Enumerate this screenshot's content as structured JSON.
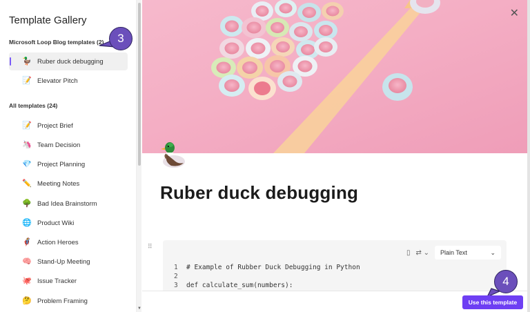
{
  "sidebar": {
    "title": "Template Gallery",
    "sections": [
      {
        "label": "Microsoft Loop Blog templates (2)",
        "items": [
          {
            "label": "Ruber duck debugging",
            "icon": "duck-icon",
            "glyph": "🦆",
            "active": true
          },
          {
            "label": "Elevator Pitch",
            "icon": "pencil-paper-icon",
            "glyph": "📝",
            "active": false
          }
        ]
      },
      {
        "label": "All templates (24)",
        "items": [
          {
            "label": "Project Brief",
            "icon": "memo-icon",
            "glyph": "📝"
          },
          {
            "label": "Team Decision",
            "icon": "unicorn-icon",
            "glyph": "🦄"
          },
          {
            "label": "Project Planning",
            "icon": "gem-icon",
            "glyph": "💎"
          },
          {
            "label": "Meeting Notes",
            "icon": "pencil-icon",
            "glyph": "✏️"
          },
          {
            "label": "Bad Idea Brainstorm",
            "icon": "tree-icon",
            "glyph": "🌳"
          },
          {
            "label": "Product Wiki",
            "icon": "globe-icon",
            "glyph": "🌐"
          },
          {
            "label": "Action Heroes",
            "icon": "superhero-icon",
            "glyph": "🦸"
          },
          {
            "label": "Stand-Up Meeting",
            "icon": "brain-icon",
            "glyph": "🧠"
          },
          {
            "label": "Issue Tracker",
            "icon": "octopus-icon",
            "glyph": "🐙"
          },
          {
            "label": "Problem Framing",
            "icon": "thinking-face-icon",
            "glyph": "🤔"
          }
        ]
      }
    ]
  },
  "callouts": {
    "step_sidebar": "3",
    "step_button": "4"
  },
  "preview": {
    "close_glyph": "✕",
    "doc_title": "Ruber duck debugging",
    "code": {
      "language": "Plain Text",
      "lines": [
        {
          "n": "1",
          "text": "# Example of Rubber Duck Debugging in Python"
        },
        {
          "n": "2",
          "text": ""
        },
        {
          "n": "3",
          "text": "def calculate_sum(numbers):"
        }
      ]
    },
    "use_button": "Use this template"
  },
  "colors": {
    "accent": "#6e3ff3",
    "callout": "#6b4fbb",
    "hero_pink": "#f4aec4"
  }
}
